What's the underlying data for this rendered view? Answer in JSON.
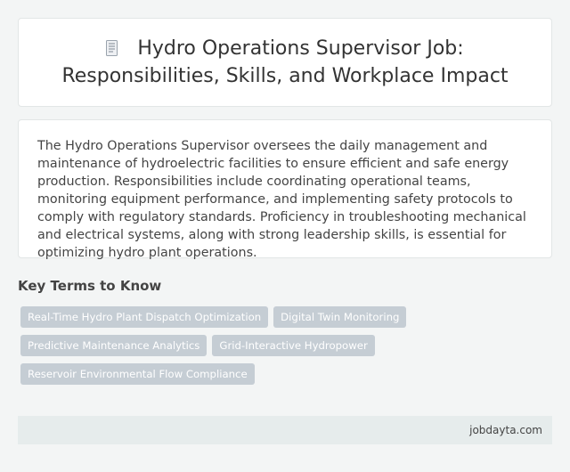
{
  "header": {
    "icon": "document-icon",
    "title": "Hydro Operations Supervisor Job: Responsibilities, Skills, and Workplace Impact"
  },
  "summary": {
    "text": "The Hydro Operations Supervisor oversees the daily management and maintenance of hydroelectric facilities to ensure efficient and safe energy production. Responsibilities include coordinating operational teams, monitoring equipment performance, and implementing safety protocols to comply with regulatory standards. Proficiency in troubleshooting mechanical and electrical systems, along with strong leadership skills, is essential for optimizing hydro plant operations."
  },
  "key_terms": {
    "heading": "Key Terms to Know",
    "tags": [
      "Real-Time Hydro Plant Dispatch Optimization",
      "Digital Twin Monitoring",
      "Predictive Maintenance Analytics",
      "Grid-Interactive Hydropower",
      "Reservoir Environmental Flow Compliance"
    ]
  },
  "footer": {
    "site": "jobdayta.com"
  },
  "colors": {
    "tag_bg": "#c5cdd4",
    "footer_bg": "#e6ecec",
    "page_bg": "#f3f5f5"
  }
}
